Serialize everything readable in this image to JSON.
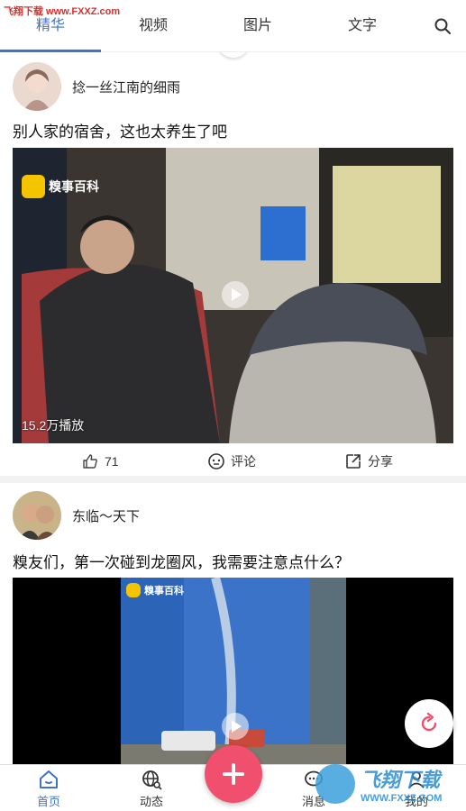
{
  "watermark_top": "飞翔下载 www.FXXZ.com",
  "tabs": [
    {
      "label": "精华",
      "active": true
    },
    {
      "label": "视频"
    },
    {
      "label": "图片"
    },
    {
      "label": "文字"
    }
  ],
  "accent_color": "#3f73c8",
  "posts": [
    {
      "author": "捻一丝江南的细雨",
      "title": "别人家的宿舍，这也太养生了吧",
      "video_watermark": "糗事百科",
      "play_count": "15.2万播放",
      "likes": "71",
      "comment_label": "评论",
      "share_label": "分享"
    },
    {
      "author": "东临～天下",
      "title": "糗友们，第一次碰到龙圈风，我需要注意点什么？",
      "video_watermark": "糗事百科"
    }
  ],
  "bottom_nav": [
    {
      "label": "首页",
      "icon": "home-icon",
      "active": true
    },
    {
      "label": "动态",
      "icon": "globe-icon"
    },
    {
      "label": "消息",
      "icon": "message-icon"
    },
    {
      "label": "我的",
      "icon": "profile-icon"
    }
  ],
  "fab_color": "#f0506e",
  "watermark_br": {
    "name": "飞翔下载",
    "url": "WWW.FXXZ.COM"
  }
}
